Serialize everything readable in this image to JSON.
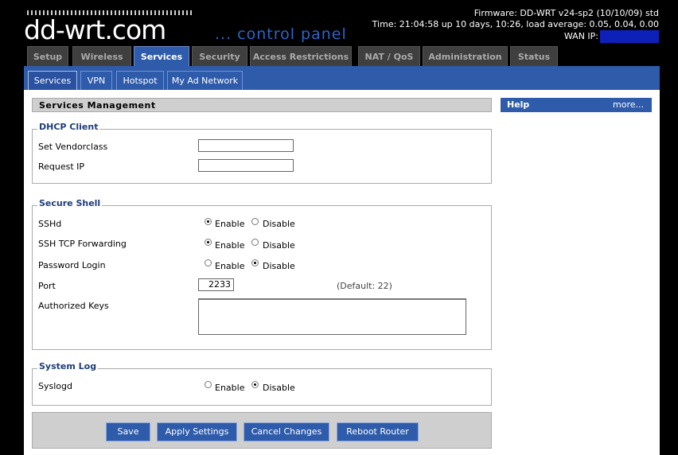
{
  "header": {
    "logo_text": "dd-wrt",
    "logo_suffix": ".com",
    "subtitle": "... control panel",
    "firmware": "Firmware: DD-WRT v24-sp2 (10/10/09) std",
    "time": "Time: 21:04:58 up 10 days, 10:26, load average: 0.05, 0.04, 0.00",
    "wan_ip_label": "WAN IP:"
  },
  "tabs": [
    "Setup",
    "Wireless",
    "Services",
    "Security",
    "Access Restrictions",
    "NAT / QoS",
    "Administration",
    "Status"
  ],
  "subtabs": [
    "Services",
    "VPN",
    "Hotspot",
    "My Ad Network"
  ],
  "page_title": "Services Management",
  "help": {
    "title": "Help",
    "more": "more..."
  },
  "dhcp": {
    "legend": "DHCP Client",
    "vendorclass_label": "Set Vendorclass",
    "vendorclass_value": "",
    "request_ip_label": "Request IP",
    "request_ip_value": ""
  },
  "ssh": {
    "legend": "Secure Shell",
    "sshd_label": "SSHd",
    "tcp_fwd_label": "SSH TCP Forwarding",
    "pw_login_label": "Password Login",
    "port_label": "Port",
    "port_value": "2233",
    "port_default": "(Default: 22)",
    "auth_keys_label": "Authorized Keys",
    "auth_keys_value": ""
  },
  "syslog": {
    "legend": "System Log",
    "syslogd_label": "Syslogd"
  },
  "radio": {
    "enable": "Enable",
    "disable": "Disable"
  },
  "buttons": {
    "save": "Save",
    "apply": "Apply Settings",
    "cancel": "Cancel Changes",
    "reboot": "Reboot Router"
  },
  "colors": {
    "accent": "#2e5baa",
    "background": "#000000",
    "tab_inactive": "#3f3f3f"
  }
}
